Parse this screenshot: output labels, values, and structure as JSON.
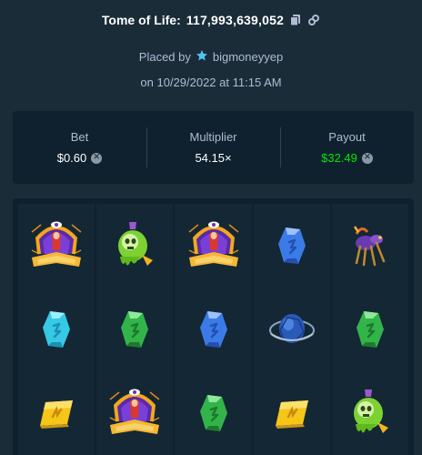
{
  "header": {
    "game_name": "Tome of Life:",
    "bet_id": "117,993,639,052",
    "placed_by_label": "Placed by",
    "username": "bigmoneyyep",
    "date_text": "on 10/29/2022 at 11:15 AM"
  },
  "stats": {
    "bet_label": "Bet",
    "bet_value": "$0.60",
    "multiplier_label": "Multiplier",
    "multiplier_value": "54.15×",
    "payout_label": "Payout",
    "payout_value": "$32.49"
  },
  "reels": [
    [
      "tome-symbol",
      "rune-gem-cyan",
      "rune-gem-yellow"
    ],
    [
      "potion-skull-symbol",
      "rune-gem-green",
      "tome-symbol"
    ],
    [
      "tome-symbol",
      "rune-gem-blue",
      "rune-gem-green"
    ],
    [
      "rune-gem-blue",
      "orb-symbol",
      "rune-gem-yellow"
    ],
    [
      "spider-symbol",
      "rune-gem-green",
      "potion-skull-symbol"
    ]
  ],
  "colors": {
    "background": "#1a2c38",
    "panel": "#0f212e",
    "payout_green": "#00e701",
    "vip_star": "#4fc3f7"
  }
}
